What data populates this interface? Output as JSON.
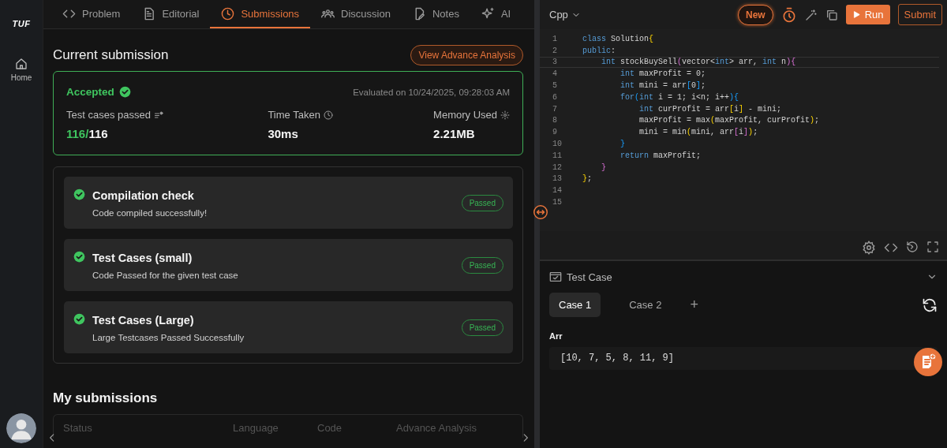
{
  "sidebar": {
    "logo": "TUF",
    "items": [
      {
        "label": "Home",
        "selected": false
      }
    ]
  },
  "tabs": [
    {
      "label": "Problem",
      "selected": false
    },
    {
      "label": "Editorial",
      "selected": false
    },
    {
      "label": "Submissions",
      "selected": true
    },
    {
      "label": "Discussion",
      "selected": false
    },
    {
      "label": "Notes",
      "selected": false
    },
    {
      "label": "AI",
      "selected": false
    }
  ],
  "current_submission": {
    "title": "Current submission",
    "analysis_button": "View Advance Analysis",
    "status": "Accepted",
    "evaluated": "Evaluated on 10/24/2025, 09:28:03 AM",
    "stats": [
      {
        "kind": "ratio",
        "label": "Test cases passed",
        "passed": "116/",
        "total": "116"
      },
      {
        "kind": "value",
        "label": "Time Taken",
        "value": "30ms"
      },
      {
        "kind": "value",
        "label": "Memory Used",
        "value": "2.21MB"
      }
    ]
  },
  "checks": [
    {
      "title": "Compilation check",
      "detail": "Code compiled successfully!",
      "badge": "Passed",
      "passed": true
    },
    {
      "title": "Test Cases (small)",
      "detail": "Code Passed for the given test case",
      "badge": "Passed",
      "passed": true
    },
    {
      "title": "Test Cases (Large)",
      "detail": "Large Testcases Passed Successfully",
      "badge": "Passed",
      "passed": true
    }
  ],
  "my_submissions": {
    "title": "My submissions",
    "columns": [
      "Status",
      "Language",
      "Code",
      "Advance Analysis"
    ]
  },
  "editor": {
    "language": "Cpp",
    "new_badge": "New",
    "run": "Run",
    "submit": "Submit",
    "lines": [
      {
        "number": "1",
        "tokens": [
          {
            "kind": "keyword",
            "t": "class"
          },
          {
            "kind": "plain",
            "t": " Solution"
          },
          {
            "kind": "depth1",
            "t": "{"
          }
        ]
      },
      {
        "number": "2",
        "tokens": [
          {
            "kind": "keyword",
            "t": "public"
          },
          {
            "kind": "plain",
            "t": ":"
          }
        ]
      },
      {
        "number": "3",
        "current": true,
        "tokens": [
          {
            "kind": "keyword",
            "t": "    int"
          },
          {
            "kind": "plain",
            "t": " stockBuySell"
          },
          {
            "kind": "depth2",
            "t": "("
          },
          {
            "kind": "plain",
            "t": "vector<"
          },
          {
            "kind": "keyword",
            "t": "int"
          },
          {
            "kind": "plain",
            "t": "> arr, "
          },
          {
            "kind": "keyword",
            "t": "int"
          },
          {
            "kind": "plain",
            "t": " n"
          },
          {
            "kind": "depth2",
            "t": "){"
          }
        ]
      },
      {
        "number": "4",
        "tokens": [
          {
            "kind": "keyword",
            "t": "        int"
          },
          {
            "kind": "plain",
            "t": " maxProfit = 0;"
          }
        ]
      },
      {
        "number": "5",
        "tokens": [
          {
            "kind": "keyword",
            "t": "        int"
          },
          {
            "kind": "plain",
            "t": " mini = arr"
          },
          {
            "kind": "depth3",
            "t": "["
          },
          {
            "kind": "plain",
            "t": "0"
          },
          {
            "kind": "depth3",
            "t": "]"
          },
          {
            "kind": "plain",
            "t": ";"
          }
        ]
      },
      {
        "number": "6",
        "tokens": [
          {
            "kind": "keyword",
            "t": "        for"
          },
          {
            "kind": "depth3",
            "t": "("
          },
          {
            "kind": "keyword",
            "t": "int"
          },
          {
            "kind": "plain",
            "t": " i = 1; i<n; i++"
          },
          {
            "kind": "depth3",
            "t": "){"
          }
        ]
      },
      {
        "number": "7",
        "tokens": [
          {
            "kind": "keyword",
            "t": "            int"
          },
          {
            "kind": "plain",
            "t": " curProfit = arr"
          },
          {
            "kind": "depth1",
            "t": "["
          },
          {
            "kind": "plain",
            "t": "i"
          },
          {
            "kind": "depth1",
            "t": "]"
          },
          {
            "kind": "plain",
            "t": " - mini;"
          }
        ]
      },
      {
        "number": "8",
        "tokens": [
          {
            "kind": "plain",
            "t": "            maxProfit = max"
          },
          {
            "kind": "depth1",
            "t": "("
          },
          {
            "kind": "plain",
            "t": "maxProfit, curProfit"
          },
          {
            "kind": "depth1",
            "t": ")"
          },
          {
            "kind": "plain",
            "t": ";"
          }
        ]
      },
      {
        "number": "9",
        "tokens": [
          {
            "kind": "plain",
            "t": "            mini = min"
          },
          {
            "kind": "depth1",
            "t": "("
          },
          {
            "kind": "plain",
            "t": "mini, arr"
          },
          {
            "kind": "depth2",
            "t": "["
          },
          {
            "kind": "plain",
            "t": "i"
          },
          {
            "kind": "depth2",
            "t": "]"
          },
          {
            "kind": "depth1",
            "t": ")"
          },
          {
            "kind": "plain",
            "t": ";"
          }
        ]
      },
      {
        "number": "10",
        "tokens": [
          {
            "kind": "depth3",
            "t": "        }"
          }
        ]
      },
      {
        "number": "11",
        "tokens": [
          {
            "kind": "keyword",
            "t": "        return"
          },
          {
            "kind": "plain",
            "t": " maxProfit;"
          }
        ]
      },
      {
        "number": "12",
        "tokens": [
          {
            "kind": "depth2",
            "t": "    }"
          }
        ]
      },
      {
        "number": "13",
        "tokens": [
          {
            "kind": "depth1",
            "t": "}"
          },
          {
            "kind": "plain",
            "t": ";"
          }
        ]
      },
      {
        "number": "14"
      },
      {
        "number": "15"
      }
    ]
  },
  "test_case": {
    "title": "Test Case",
    "cases": [
      {
        "label": "Case 1",
        "selected": true
      },
      {
        "label": "Case 2",
        "selected": false
      }
    ],
    "add": "+",
    "param": "Arr",
    "value": "[10, 7, 5, 8, 11, 9]"
  }
}
